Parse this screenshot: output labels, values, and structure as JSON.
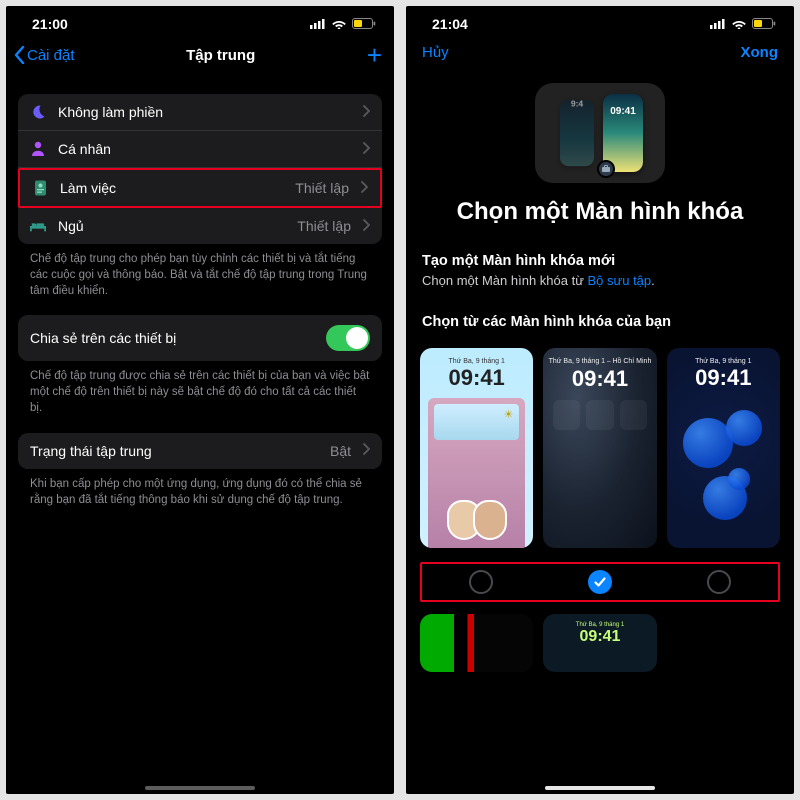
{
  "left": {
    "status_time": "21:00",
    "nav_back": "Cài đặt",
    "nav_title": "Tập trung",
    "rows": [
      {
        "label": "Không làm phiền",
        "detail": ""
      },
      {
        "label": "Cá nhân",
        "detail": ""
      },
      {
        "label": "Làm việc",
        "detail": "Thiết lập"
      },
      {
        "label": "Ngủ",
        "detail": "Thiết lập"
      }
    ],
    "desc1": "Chế độ tập trung cho phép bạn tùy chỉnh các thiết bị và tắt tiếng các cuộc gọi và thông báo. Bật và tắt chế độ tập trung trong Trung tâm điều khiển.",
    "share_label": "Chia sẻ trên các thiết bị",
    "desc2": "Chế độ tập trung được chia sẻ trên các thiết bị của bạn và việc bật một chế độ trên thiết bị này sẽ bật chế độ đó cho tất cả các thiết bị.",
    "status_row_label": "Trạng thái tập trung",
    "status_row_detail": "Bật",
    "desc3": "Khi bạn cấp phép cho một ứng dụng, ứng dụng đó có thể chia sẻ rằng bạn đã tắt tiếng thông báo khi sử dụng chế độ tập trung."
  },
  "right": {
    "status_time": "21:04",
    "cancel": "Hủy",
    "done": "Xong",
    "ill_time": "09:41",
    "ill_time_small": "9:4",
    "title": "Chọn một Màn hình khóa",
    "create_title": "Tạo một Màn hình khóa mới",
    "create_sub_a": "Chọn một Màn hình khóa từ ",
    "create_sub_link": "Bộ sưu tập",
    "choose_title": "Chọn từ các Màn hình khóa của bạn",
    "wall_date": "Thứ Ba, 9 tháng 1",
    "wall_date_loc": "Thứ Ba, 9 tháng 1 ⎯ Hồ Chí Minh",
    "wall_time": "09:41",
    "wall2_time": "09:41"
  }
}
